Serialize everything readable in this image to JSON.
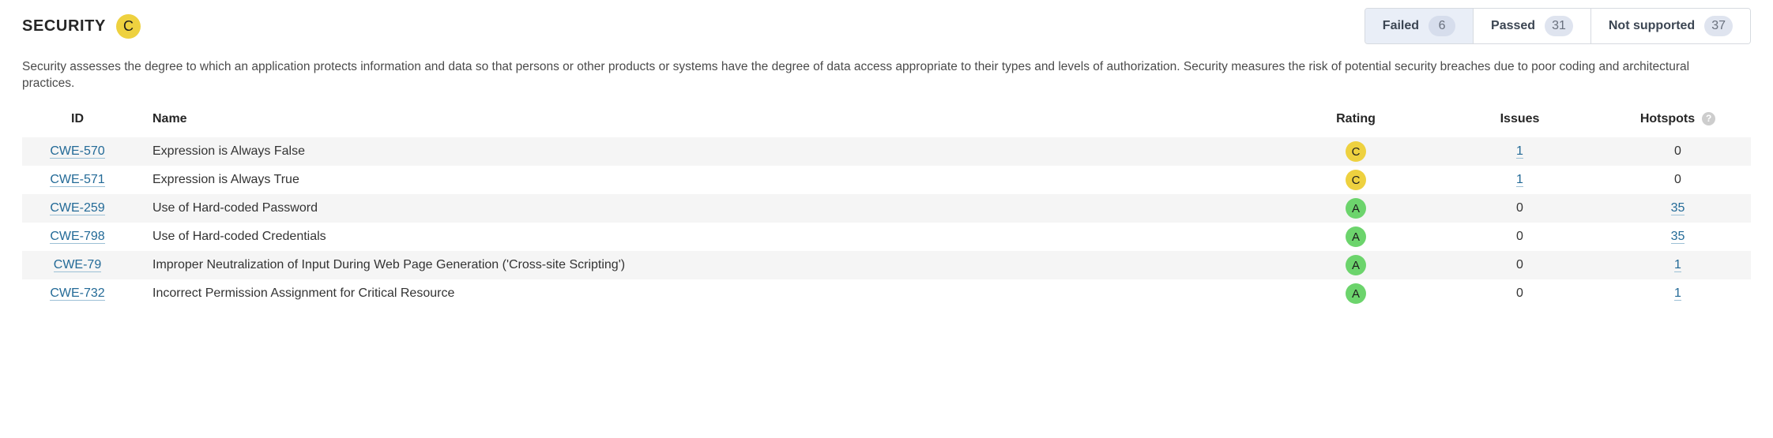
{
  "header": {
    "title": "SECURITY",
    "rating": "C",
    "rating_color": "#eed13f"
  },
  "filters": [
    {
      "label": "Failed",
      "count": "6",
      "selected": true,
      "name": "filter-failed"
    },
    {
      "label": "Passed",
      "count": "31",
      "selected": false,
      "name": "filter-passed"
    },
    {
      "label": "Not supported",
      "count": "37",
      "selected": false,
      "name": "filter-not-supported"
    }
  ],
  "description": "Security assesses the degree to which an application protects information and data so that persons or other products or systems have the degree of data access appropriate to their types and levels of authorization. Security measures the risk of potential security breaches due to poor coding and architectural practices.",
  "table": {
    "columns": {
      "id": "ID",
      "name": "Name",
      "rating": "Rating",
      "issues": "Issues",
      "hotspots": "Hotspots"
    },
    "hotspots_help_icon": "help-icon",
    "rows": [
      {
        "id": "CWE-570",
        "name": "Expression is Always False",
        "rating": "C",
        "rating_color": "#eed13f",
        "issues": "1",
        "issues_link": true,
        "hotspots": "0",
        "hotspots_link": false
      },
      {
        "id": "CWE-571",
        "name": "Expression is Always True",
        "rating": "C",
        "rating_color": "#eed13f",
        "issues": "1",
        "issues_link": true,
        "hotspots": "0",
        "hotspots_link": false
      },
      {
        "id": "CWE-259",
        "name": "Use of Hard-coded Password",
        "rating": "A",
        "rating_color": "#6cd46c",
        "issues": "0",
        "issues_link": false,
        "hotspots": "35",
        "hotspots_link": true
      },
      {
        "id": "CWE-798",
        "name": "Use of Hard-coded Credentials",
        "rating": "A",
        "rating_color": "#6cd46c",
        "issues": "0",
        "issues_link": false,
        "hotspots": "35",
        "hotspots_link": true
      },
      {
        "id": "CWE-79",
        "name": "Improper Neutralization of Input During Web Page Generation ('Cross-site Scripting')",
        "rating": "A",
        "rating_color": "#6cd46c",
        "issues": "0",
        "issues_link": false,
        "hotspots": "1",
        "hotspots_link": true
      },
      {
        "id": "CWE-732",
        "name": "Incorrect Permission Assignment for Critical Resource",
        "rating": "A",
        "rating_color": "#6cd46c",
        "issues": "0",
        "issues_link": false,
        "hotspots": "1",
        "hotspots_link": true
      }
    ]
  },
  "colors": {
    "rating_a": "#6cd46c",
    "rating_c": "#eed13f",
    "link": "#236a97",
    "selected_filter_bg": "#e9eef7",
    "row_stripe": "#f5f5f5"
  }
}
